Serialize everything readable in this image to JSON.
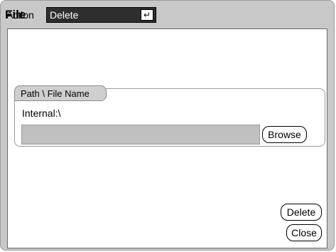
{
  "window": {
    "title": "File"
  },
  "action": {
    "label": "Action",
    "selected": "Delete",
    "enter_icon": "enter-key-icon",
    "enter_glyph": "↵"
  },
  "path_group": {
    "header": "Path \\ File Name",
    "path_value": "Internal:\\",
    "filename_value": "",
    "browse_label": "Browse"
  },
  "buttons": {
    "delete_label": "Delete",
    "close_label": "Close"
  },
  "colors": {
    "frame_bg": "#c8c8c8",
    "panel_bg": "#ffffff",
    "select_bg": "#2e2e2e",
    "select_text": "#ffffff"
  }
}
